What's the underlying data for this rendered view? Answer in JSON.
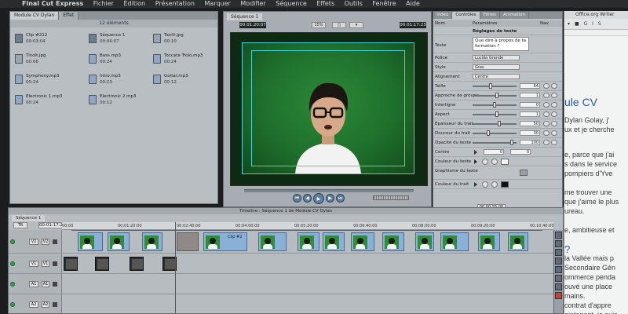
{
  "menu": {
    "app": "Final Cut Express",
    "items": [
      "Fichier",
      "Édition",
      "Présentation",
      "Marquer",
      "Modifier",
      "Séquence",
      "Effets",
      "Outils",
      "Fenêtre",
      "Aide"
    ]
  },
  "browser": {
    "tabs": [
      "Module CV Dylan",
      "Effet"
    ],
    "count": "12 éléments",
    "clips": [
      {
        "name": "Clip #212",
        "dur": "00:03:04",
        "kind": "video"
      },
      {
        "name": "Séquence 1",
        "dur": "00:06:07",
        "kind": "video"
      },
      {
        "name": "Tanilt.jpg",
        "dur": "00:10",
        "kind": "img"
      },
      {
        "name": "Tinolt.jpg",
        "dur": "00:06",
        "kind": "img"
      },
      {
        "name": "Bass.mp3",
        "dur": "00:24",
        "kind": "audio"
      },
      {
        "name": "Toccata Trolo.mp3",
        "dur": "00:24",
        "kind": "audio"
      },
      {
        "name": "Symphony.mp3",
        "dur": "00:24",
        "kind": "audio"
      },
      {
        "name": "Intro.mp3",
        "dur": "00:23",
        "kind": "audio"
      },
      {
        "name": "Guitar.mp3",
        "dur": "00:12",
        "kind": "audio"
      },
      {
        "name": "Electronic 1.mp3",
        "dur": "00:24",
        "kind": "audio"
      },
      {
        "name": "Electronic 2.mp3",
        "dur": "00:12",
        "kind": "audio"
      }
    ]
  },
  "viewer": {
    "tab": "Séquence 1",
    "timecode_left": "00:01:20:07",
    "timecode_right": "00:01:17:23",
    "zoom": "15%",
    "view": "◫",
    "overlay": "▾"
  },
  "inspector": {
    "tabs": [
      "Vidéo",
      "Contrôles",
      "Filtres",
      "Animation"
    ],
    "col_name": "Nom",
    "col_params": "Paramètres",
    "col_nav": "Nav",
    "section": "Réglages de texte",
    "text_label": "Texte",
    "text_value": "Que dire à propos de ta formation ?",
    "rows": [
      {
        "label": "Police",
        "type": "select",
        "value": "Lucida Grande"
      },
      {
        "label": "Style",
        "type": "select",
        "value": "Gras"
      },
      {
        "label": "Alignement",
        "type": "select",
        "value": "Centre"
      },
      {
        "label": "Taille",
        "type": "slider",
        "value": "64",
        "pos": 0.4
      },
      {
        "label": "Approche de groupe",
        "type": "slider",
        "value": "1",
        "pos": 0.55
      },
      {
        "label": "Interligne",
        "type": "slider",
        "value": "0",
        "pos": 0.5
      },
      {
        "label": "Aspect",
        "type": "slider",
        "value": "1",
        "pos": 0.55
      },
      {
        "label": "Épaisseur du trait",
        "type": "slider",
        "value": "50",
        "pos": 0.62
      },
      {
        "label": "Douceur du trait",
        "type": "slider",
        "value": "30",
        "pos": 0.35
      },
      {
        "label": "Opacité du texte",
        "type": "slider",
        "value": "100",
        "pos": 0.92
      },
      {
        "label": "Centre",
        "type": "center",
        "value": "0",
        "value2": "0"
      },
      {
        "label": "Couleur du texte",
        "type": "color",
        "color": "#f4f4f4"
      },
      {
        "label": "Graphisme du texte",
        "type": "graphic"
      },
      {
        "label": "Couleur du trait",
        "type": "color",
        "color": "#111111"
      }
    ],
    "footer_timecode": "00:00:55:00"
  },
  "timeline": {
    "title": "Timeline : Séquence 1 de Module CV Dylan",
    "tab": "Séquence 1",
    "dropdown": "TR",
    "timecode": "00:01:17:23",
    "ruler": [
      "00:00",
      "00:01:20:00",
      "00:02:40:00",
      "00:04:00:00",
      "00:05:20:00",
      "00:06:40:00",
      "00:08:00:00",
      "00:09:20:00",
      "00:10:40:00"
    ],
    "tracks": [
      {
        "a": "V2",
        "b": "V2"
      },
      {
        "a": "V1",
        "b": "V1"
      },
      {
        "a": "A1",
        "b": "A1"
      },
      {
        "a": "A2",
        "b": "A2"
      }
    ],
    "clip_label": "Clip #2 "
  },
  "document": {
    "title": "Office.org Writer",
    "heading": "ule CV",
    "lines": [
      " Dylan Golay, j'",
      "ux et je cherche",
      "e, parce que j'ai",
      "s dans le service",
      "pompiers d'Yve",
      "me trouver une",
      "que j'aime le plus",
      "ureau.",
      "e, ambitieuse et",
      "la Vallée mais p",
      "Secondaire Gén",
      "ommerce penda",
      "ouvé une place",
      "mains.",
      "contrat d'appre",
      "aintenant, je suis"
    ]
  }
}
